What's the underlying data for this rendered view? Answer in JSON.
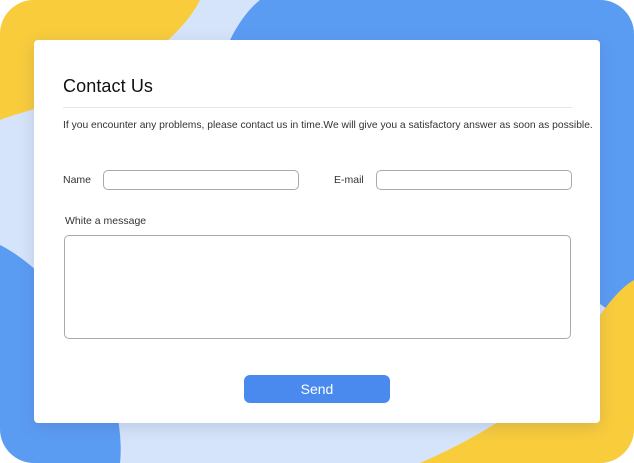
{
  "form": {
    "title": "Contact Us",
    "description": "If you encounter any problems, please contact us in time.We will give you a satisfactory answer as soon as possible.",
    "name_label": "Name",
    "name_value": "",
    "email_label": "E-mail",
    "email_value": "",
    "message_label": "White a message",
    "message_value": "",
    "send_label": "Send"
  },
  "colors": {
    "background_light": "#d6e4fb",
    "background_blue": "#5b9cf3",
    "background_yellow": "#f9cc3c",
    "button": "#4a89ee"
  }
}
